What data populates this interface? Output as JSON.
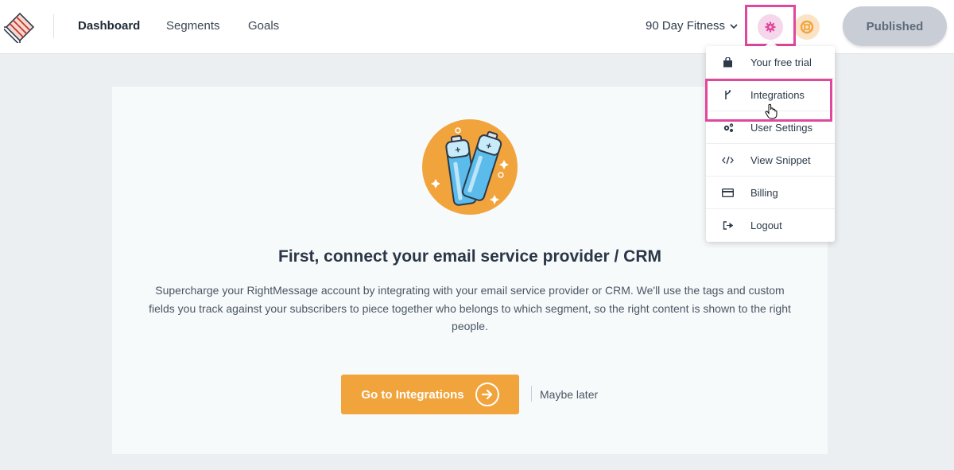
{
  "nav": {
    "items": [
      {
        "label": "Dashboard",
        "active": true
      },
      {
        "label": "Segments",
        "active": false
      },
      {
        "label": "Goals",
        "active": false
      }
    ],
    "site_selector": "90 Day Fitness",
    "publish_label": "Published"
  },
  "dropdown": {
    "items": [
      {
        "label": "Your free trial",
        "icon": "shopping-bag-icon"
      },
      {
        "label": "Integrations",
        "icon": "branch-icon"
      },
      {
        "label": "User Settings",
        "icon": "gears-icon"
      },
      {
        "label": "View Snippet",
        "icon": "code-icon"
      },
      {
        "label": "Billing",
        "icon": "credit-card-icon"
      },
      {
        "label": "Logout",
        "icon": "sign-out-icon"
      }
    ]
  },
  "card": {
    "title": "First, connect your email service provider / CRM",
    "description": "Supercharge your RightMessage account by integrating with your email service provider or CRM. We'll use the tags and custom fields you track against your subscribers to piece together who belongs to which segment, so the right content is shown to the right people.",
    "cta_label": "Go to Integrations",
    "later_label": "Maybe later"
  },
  "colors": {
    "accent": "#f2a43c",
    "highlight": "#e0479e",
    "gear_bg": "#f5d6ea",
    "help_bg": "#fbe3c5"
  }
}
